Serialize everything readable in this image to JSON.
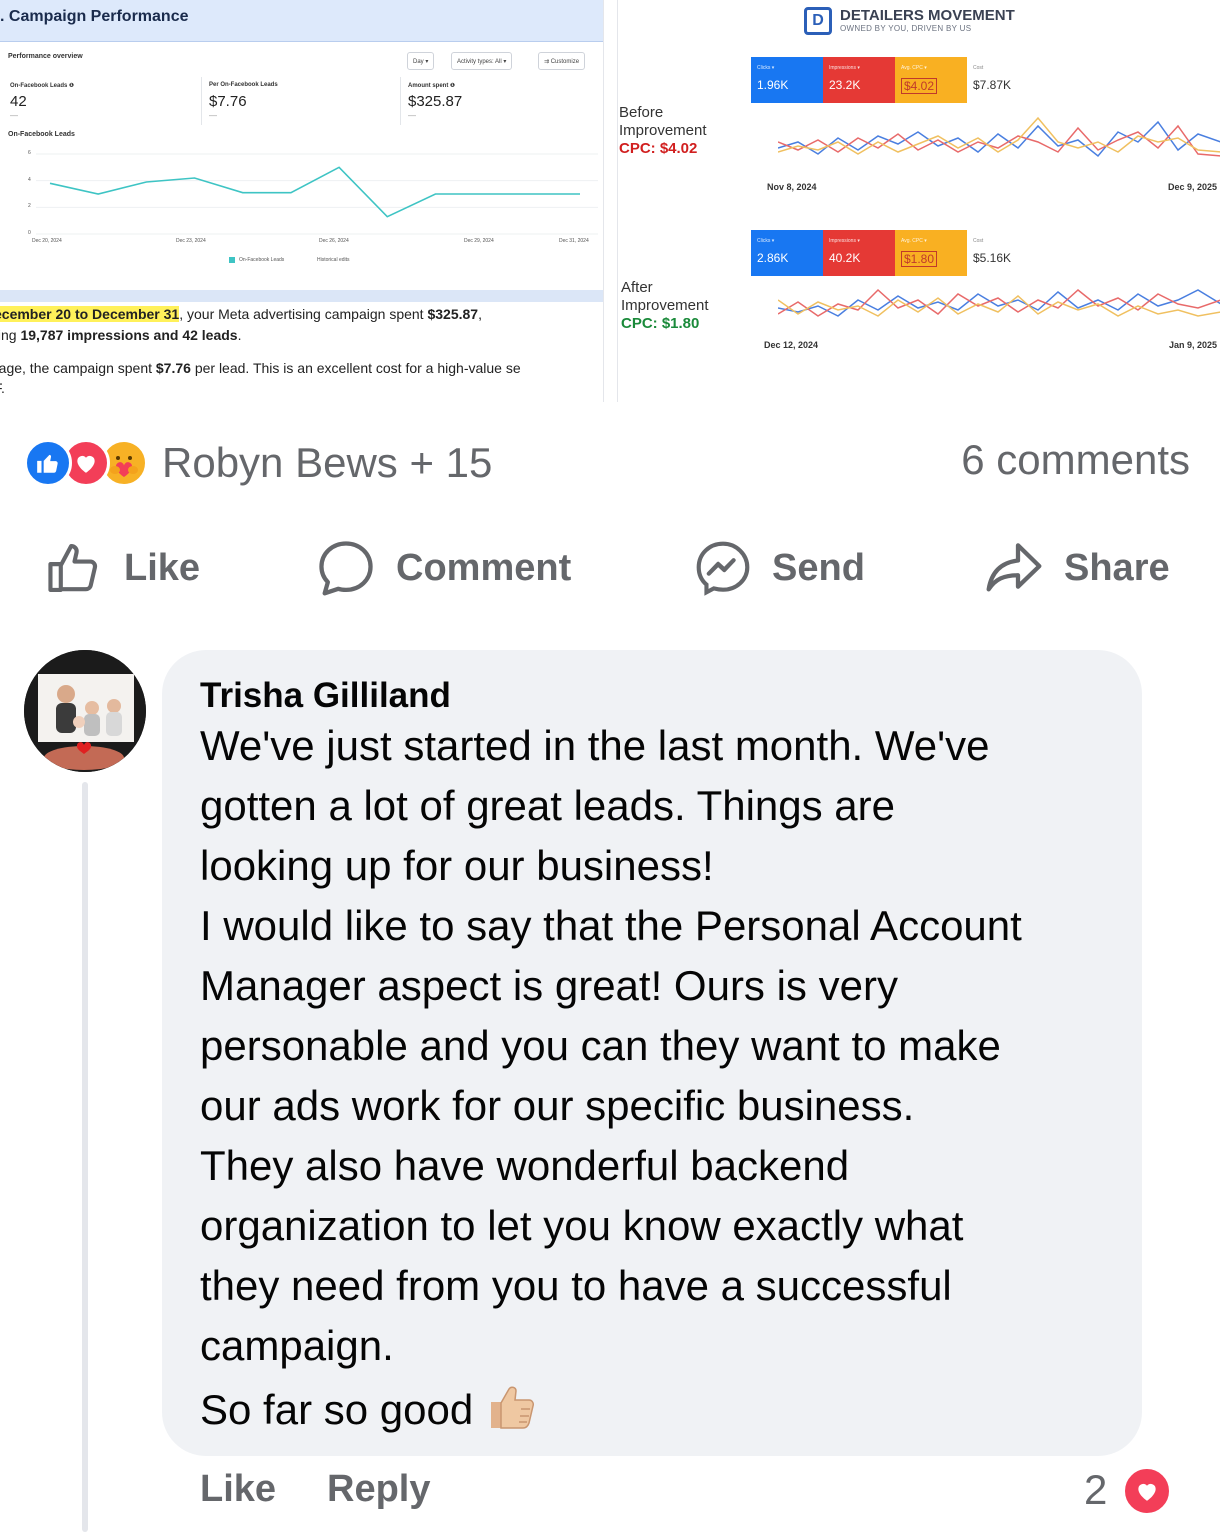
{
  "left_image": {
    "title": ". Campaign Performance",
    "overview_label": "Performance overview",
    "buttons": [
      "Day ▾",
      "Activity types: All ▾",
      "⇉ Customize"
    ],
    "metrics": [
      {
        "label": "On-Facebook Leads ❶",
        "value": "42",
        "sub": "—"
      },
      {
        "label": "Per On-Facebook Leads",
        "value": "$7.76",
        "sub": "—"
      },
      {
        "label": "Amount spent ❶",
        "value": "$325.87",
        "sub": "—"
      }
    ],
    "chart_label": "On-Facebook Leads",
    "legend": [
      "On-Facebook Leads",
      "Historical edits"
    ],
    "summary_line1": {
      "range": "ecember 20 to December 31",
      "text_a": ", your Meta advertising campaign spent ",
      "spent": "$325.87",
      "text_b": ","
    },
    "summary_line2": {
      "text_a": "ting ",
      "impressions": "19,787 impressions and 42 leads",
      "text_b": "."
    },
    "summary_line3": {
      "text_a": "rage, the campaign spent ",
      "per_lead": "$7.76",
      "text_b": " per lead. This is an excellent cost for a high-value se"
    },
    "summary_line4": "F."
  },
  "chart_data": {
    "type": "line",
    "title": "On-Facebook Leads",
    "categories": [
      "Dec 20",
      "Dec 21",
      "Dec 22",
      "Dec 23",
      "Dec 24",
      "Dec 25",
      "Dec 26",
      "Dec 27",
      "Dec 28",
      "Dec 29",
      "Dec 30",
      "Dec 31"
    ],
    "series": [
      {
        "name": "On-Facebook Leads",
        "values": [
          3.8,
          3.0,
          3.9,
          4.2,
          3.1,
          3.1,
          5.0,
          1.3,
          3.0,
          3.0,
          3.0,
          3.0
        ]
      }
    ],
    "ylim": [
      0,
      6
    ],
    "y_ticks": [
      "0",
      "2",
      "4",
      "6"
    ],
    "x_tick_labels": [
      "Dec 20, 2024",
      "Dec 23, 2024",
      "Dec 26, 2024",
      "Dec 29, 2024",
      "Dec 31, 2024"
    ],
    "line_color": "#3ec4c4"
  },
  "right_image": {
    "brand": "DETAILERS MOVEMENT",
    "brand_letter": "D",
    "tagline": "OWNED BY YOU, DRIVEN BY US",
    "before": {
      "label_1": "Before",
      "label_2": "Improvement",
      "cpc": "CPC: $4.02",
      "stats": [
        {
          "label": "Clicks ▾",
          "value": "1.96K",
          "color": "#1877f2"
        },
        {
          "label": "Impressions ▾",
          "value": "23.2K",
          "color": "#e53935"
        },
        {
          "label": "Avg. CPC ▾",
          "value": "$4.02",
          "color": "#f9b022"
        },
        {
          "label": "Cost",
          "value": "$7.87K",
          "color": "#ffffff"
        }
      ],
      "date_start": "Nov 8, 2024",
      "date_end": "Dec 9, 2025"
    },
    "after": {
      "label_1": "After",
      "label_2": "Improvement",
      "cpc": "CPC: $1.80",
      "stats": [
        {
          "label": "Clicks ▾",
          "value": "2.86K",
          "color": "#1877f2"
        },
        {
          "label": "Impressions ▾",
          "value": "40.2K",
          "color": "#e53935"
        },
        {
          "label": "Avg. CPC ▾",
          "value": "$1.80",
          "color": "#f9b022"
        },
        {
          "label": "Cost",
          "value": "$5.16K",
          "color": "#ffffff"
        }
      ],
      "date_start": "Dec 12, 2024",
      "date_end": "Jan 9, 2025"
    }
  },
  "post": {
    "reactions": [
      "like-icon",
      "love-icon",
      "care-icon"
    ],
    "reactors": "Robyn Bews + 15",
    "comments_count": "6 comments"
  },
  "actions": {
    "like": "Like",
    "comment": "Comment",
    "send": "Send",
    "share": "Share"
  },
  "comment": {
    "author": "Trisha Gilliland",
    "text": "We've just started in the last month. We've\ngotten a lot of great leads. Things are\nlooking up for our business!\nI would like to say that the Personal Account\nManager aspect is great! Ours is very\npersonable and you can they want to make\nour ads work for our specific business.\nThey also have wonderful backend\norganization to let you know exactly what\nthey need from you to have a successful\ncampaign.\nSo far so good",
    "emoji": "👍🏼",
    "like_label": "Like",
    "reply_label": "Reply",
    "reaction_count": "2",
    "reaction_icon": "love-icon"
  },
  "colors": {
    "facebook_blue": "#1877f2",
    "love_red": "#f33e58",
    "muted_text": "#65676b",
    "bubble_bg": "#f0f2f5"
  }
}
